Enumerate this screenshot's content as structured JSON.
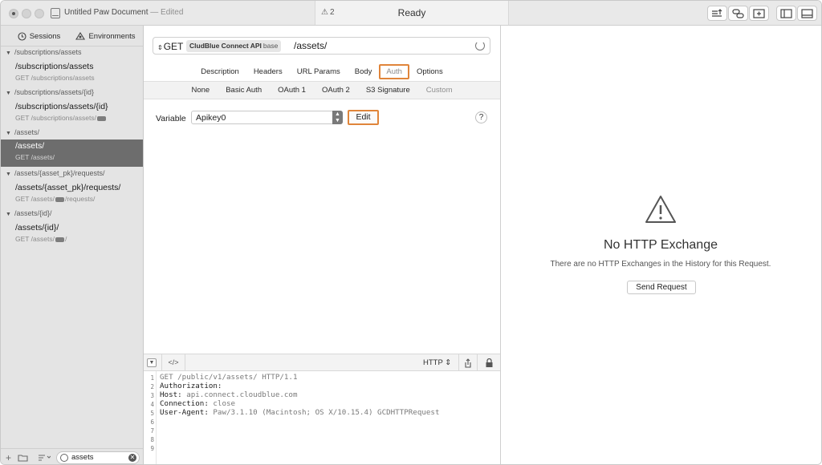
{
  "titlebar": {
    "document_title": "Untitled Paw Document",
    "edited_label": "— Edited",
    "warning_count": "2",
    "status": "Ready",
    "toolbar_icons": [
      "export-icon",
      "link-icon",
      "add-panel-icon",
      "sidebar-toggle-icon",
      "bottom-panel-toggle-icon"
    ]
  },
  "sidebar": {
    "tabs": [
      {
        "label": "Sessions",
        "icon": "clock-icon"
      },
      {
        "label": "Environments",
        "icon": "environment-icon"
      }
    ],
    "groups": [
      {
        "header": "/subscriptions/assets",
        "requests": [
          {
            "name": "/subscriptions/assets",
            "method_path_pre": "GET /subscriptions/assets",
            "method_path_post": ""
          }
        ]
      },
      {
        "header": "/subscriptions/assets/{id}",
        "requests": [
          {
            "name": "/subscriptions/assets/{id}",
            "method_path_pre": "GET /subscriptions/assets/",
            "method_path_post": ""
          }
        ]
      },
      {
        "header": "/assets/",
        "requests": [
          {
            "name": "/assets/",
            "method_path_pre": "GET /assets/",
            "method_path_post": "",
            "selected": true
          }
        ]
      },
      {
        "header": "/assets/{asset_pk}/requests/",
        "requests": [
          {
            "name": "/assets/{asset_pk}/requests/",
            "method_path_pre": "GET /assets/",
            "method_path_post": "/requests/"
          }
        ]
      },
      {
        "header": "/assets/{id}/",
        "requests": [
          {
            "name": "/assets/{id}/",
            "method_path_pre": "GET /assets/",
            "method_path_post": "/"
          }
        ]
      }
    ],
    "filter_value": "assets"
  },
  "request": {
    "method": "GET",
    "env_token": "CludBlue Connect API",
    "env_token_suffix": "base",
    "path": "/assets/"
  },
  "tabs": [
    "Description",
    "Headers",
    "URL Params",
    "Body",
    "Auth",
    "Options"
  ],
  "active_tab": "Auth",
  "auth_tabs": [
    "None",
    "Basic Auth",
    "OAuth 1",
    "OAuth 2",
    "S3 Signature",
    "Custom"
  ],
  "active_auth_tab": "Custom",
  "custom_auth": {
    "variable_label": "Variable",
    "variable_value": "Apikey0",
    "edit_label": "Edit",
    "help_label": "?"
  },
  "preview": {
    "format": "HTTP",
    "code_toggle": "</>",
    "lines": [
      {
        "num": "1",
        "key": "",
        "text": "GET /public/v1/assets/ HTTP/1.1"
      },
      {
        "num": "2",
        "key": "Authorization:",
        "text": ""
      },
      {
        "num": "3",
        "key": "Host:",
        "text": " api.connect.cloudblue.com"
      },
      {
        "num": "4",
        "key": "Connection:",
        "text": " close"
      },
      {
        "num": "5",
        "key": "User-Agent:",
        "text": " Paw/3.1.10 (Macintosh; OS X/10.15.4) GCDHTTPRequest"
      },
      {
        "num": "6",
        "key": "",
        "text": ""
      },
      {
        "num": "7",
        "key": "",
        "text": ""
      },
      {
        "num": "8",
        "key": "",
        "text": ""
      },
      {
        "num": "9",
        "key": "",
        "text": ""
      }
    ]
  },
  "response": {
    "title": "No HTTP Exchange",
    "subtitle": "There are no HTTP Exchanges in the History for this Request.",
    "send_label": "Send Request"
  },
  "colors": {
    "highlight": "#e0853a",
    "selected_row": "#6d6d6d",
    "sidebar_bg": "#e4e4e4"
  }
}
